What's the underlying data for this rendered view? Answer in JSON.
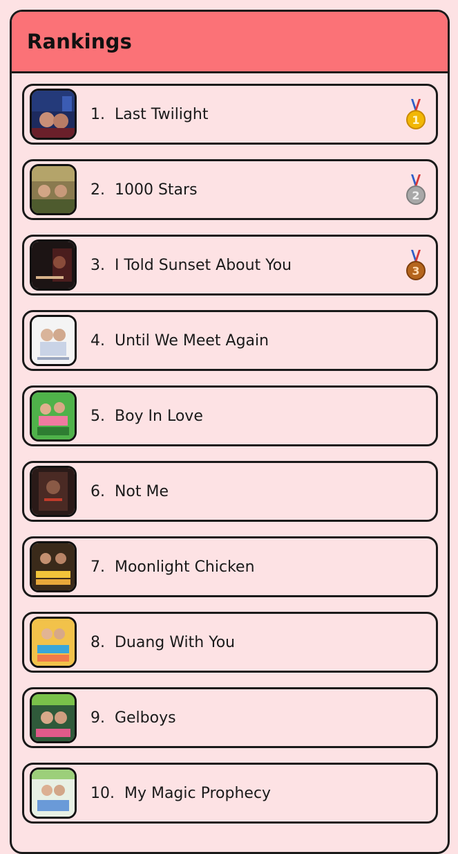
{
  "header": {
    "title": "Rankings"
  },
  "rankings": [
    {
      "label": "1.  Last Twilight",
      "medal": "gold-medal-icon"
    },
    {
      "label": "2.  1000 Stars",
      "medal": "silver-medal-icon"
    },
    {
      "label": "3.  I Told Sunset About You",
      "medal": "bronze-medal-icon"
    },
    {
      "label": "4.  Until We Meet Again"
    },
    {
      "label": "5.  Boy In Love"
    },
    {
      "label": "6.  Not Me"
    },
    {
      "label": "7.  Moonlight Chicken"
    },
    {
      "label": "8.  Duang With You"
    },
    {
      "label": "9.  Gelboys"
    },
    {
      "label": "10.  My Magic Prophecy"
    }
  ],
  "medal_numbers": [
    "1",
    "2",
    "3"
  ],
  "colors": {
    "header_bg": "#fb7277",
    "page_bg": "#fde2e4",
    "border": "#1a1a1a",
    "gold": "#f2b705",
    "silver": "#a8a8a8",
    "bronze": "#b5651d"
  }
}
